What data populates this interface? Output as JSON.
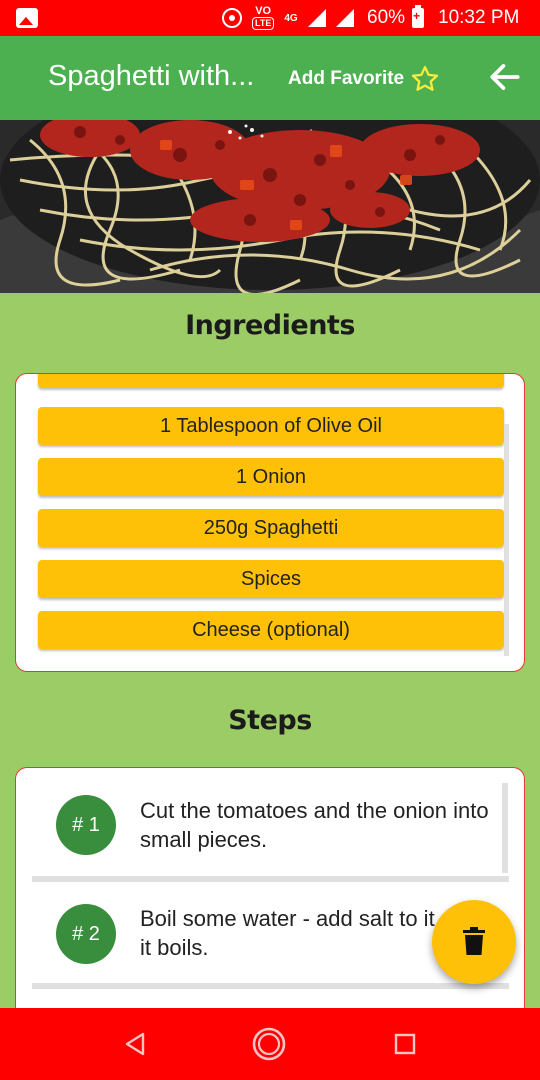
{
  "status_bar": {
    "volte_label": "VO",
    "lte_label": "LTE",
    "network_type": "4G",
    "battery": "60%",
    "time": "10:32 PM",
    "icons": [
      "gallery-icon",
      "hotspot-icon",
      "signal-icon",
      "battery-icon"
    ]
  },
  "app_bar": {
    "title": "Spaghetti with...",
    "favorite_label": "Add Favorite",
    "favorite_icon": "star-outline-icon",
    "back_icon": "arrow-back-icon",
    "color": "#4caf50"
  },
  "ingredients": {
    "title": "Ingredients",
    "items": [
      "1 Tablespoon of Olive Oil",
      "1 Onion",
      "250g Spaghetti",
      "Spices",
      "Cheese (optional)"
    ],
    "item_color": "#ffc107"
  },
  "steps": {
    "title": "Steps",
    "items": [
      {
        "number": "# 1",
        "text": "Cut the tomatoes and the onion into small pieces."
      },
      {
        "number": "# 2",
        "text": "Boil some water - add salt to it once it boils."
      }
    ],
    "badge_color": "#388e3c"
  },
  "fab": {
    "icon": "trash-icon",
    "color": "#ffc107"
  },
  "nav_bar": {
    "icons": [
      "back-triangle-icon",
      "home-circle-icon",
      "recents-square-icon"
    ],
    "color": "#ff0000"
  }
}
